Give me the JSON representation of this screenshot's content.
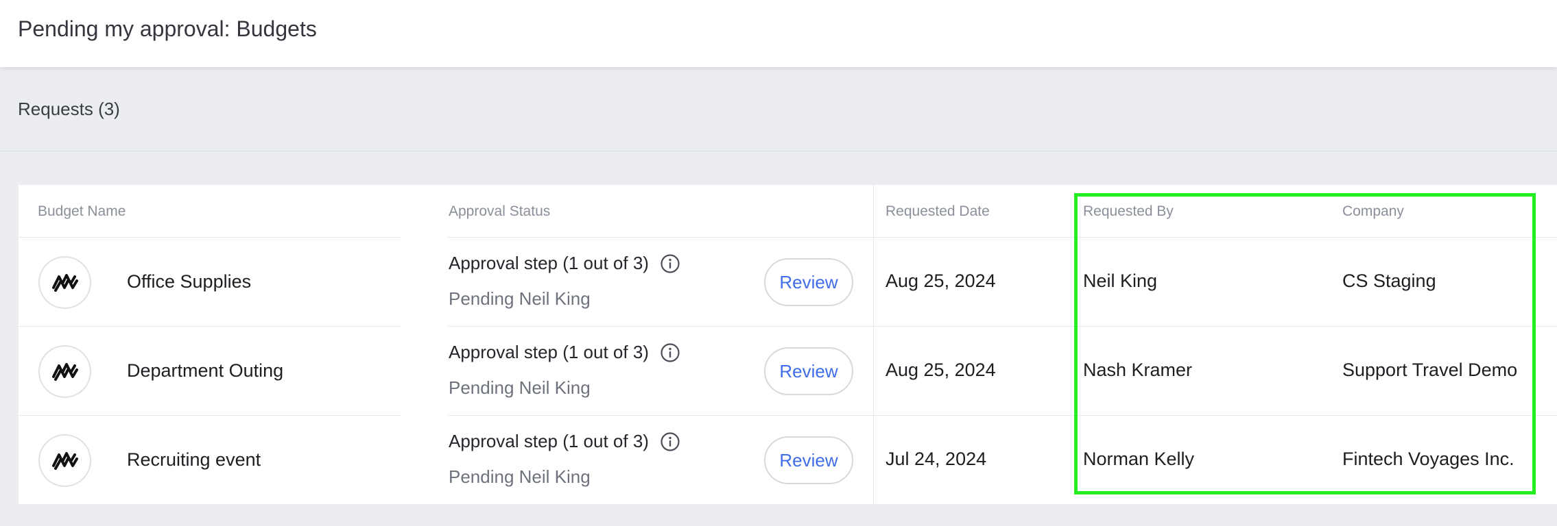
{
  "header": {
    "title": "Pending my approval: Budgets"
  },
  "section": {
    "title": "Requests (3)"
  },
  "table": {
    "columns": {
      "budget_name": "Budget Name",
      "approval_status": "Approval Status",
      "requested_date": "Requested Date",
      "requested_by": "Requested By",
      "company": "Company"
    },
    "review_label": "Review",
    "rows": [
      {
        "icon": "company-logo-icon",
        "budget_name": "Office Supplies",
        "approval_step": "Approval step (1 out of 3)",
        "pending": "Pending Neil King",
        "requested_date": "Aug 25, 2024",
        "requested_by": "Neil King",
        "company": "CS Staging"
      },
      {
        "icon": "company-logo-icon",
        "budget_name": "Department Outing",
        "approval_step": "Approval step (1 out of 3)",
        "pending": "Pending Neil King",
        "requested_date": "Aug 25, 2024",
        "requested_by": "Nash Kramer",
        "company": "Support Travel Demo"
      },
      {
        "icon": "company-logo-icon",
        "budget_name": "Recruiting event",
        "approval_step": "Approval step (1 out of 3)",
        "pending": "Pending Neil King",
        "requested_date": "Jul 24, 2024",
        "requested_by": "Norman Kelly",
        "company": "Fintech Voyages Inc."
      }
    ]
  },
  "colors": {
    "accent": "#3f6ce8",
    "highlight": "#22ee22",
    "background": "#ebedf0"
  }
}
